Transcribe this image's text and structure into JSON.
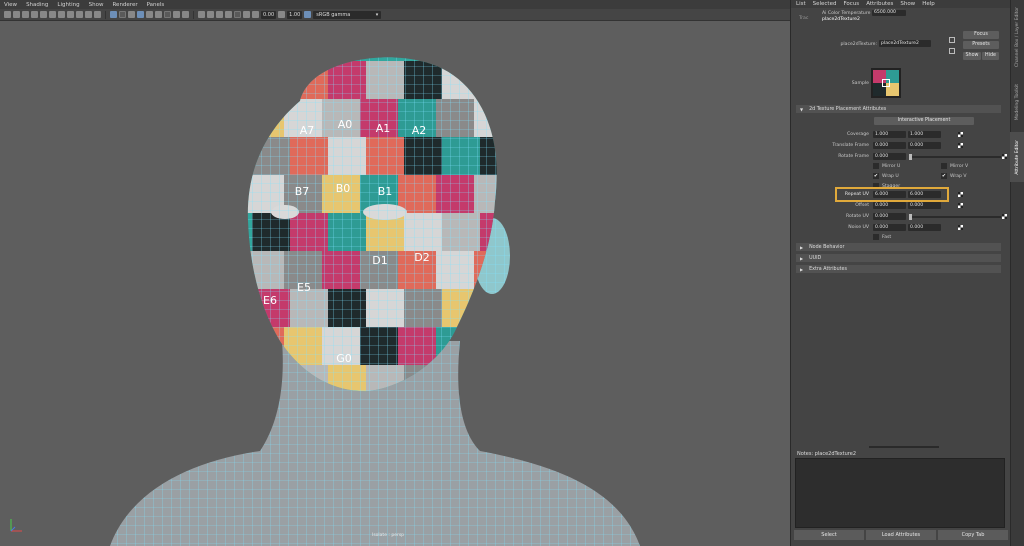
{
  "viewport": {
    "menu": [
      "View",
      "Shading",
      "Lighting",
      "Show",
      "Renderer",
      "Panels"
    ],
    "toolbar": {
      "field1": "0.00",
      "field2": "1.00",
      "colorspace": "sRGB gamma"
    },
    "label": "Isolate : persp",
    "uv_tiles": {
      "row1": [
        "A7",
        "A0",
        "A1",
        "A2"
      ],
      "row2": [
        "B7",
        "B0",
        "B1"
      ],
      "row3": [
        "D1",
        "D2"
      ],
      "row4": [
        "E6",
        "E5"
      ],
      "row5": [
        "G0"
      ]
    },
    "colors": {
      "background": "#5e5e5e",
      "wireframe": "#7fe3ff"
    }
  },
  "panel": {
    "menu": [
      "List",
      "Selected",
      "Focus",
      "Attributes",
      "Show",
      "Help"
    ],
    "top_tab": {
      "prefix": "Trac",
      "name": "place2dTexture2"
    },
    "ai_color_temp": {
      "label": "Ai Color Temperature",
      "value": "6500.000"
    },
    "node": {
      "label": "place2dTexture:",
      "value": "place2dTexture2"
    },
    "buttons": {
      "focus": "Focus",
      "presets": "Presets",
      "show": "Show",
      "hide": "Hide"
    },
    "sample_label": "Sample",
    "section_main": "2d Texture Placement Attributes",
    "interactive_placement": "Interactive Placement",
    "rows": {
      "coverage": {
        "label": "Coverage",
        "v1": "1.000",
        "v2": "1.000"
      },
      "translate_frame": {
        "label": "Translate Frame",
        "v1": "0.000",
        "v2": "0.000"
      },
      "rotate_frame": {
        "label": "Rotate Frame",
        "v1": "0.000"
      },
      "repeat_uv": {
        "label": "Repeat UV",
        "v1": "6.000",
        "v2": "6.000"
      },
      "offset": {
        "label": "Offset",
        "v1": "0.000",
        "v2": "0.000"
      },
      "rotate_uv": {
        "label": "Rotate UV",
        "v1": "0.000"
      },
      "noise_uv": {
        "label": "Noise UV",
        "v1": "0.000",
        "v2": "0.000"
      }
    },
    "checks": {
      "mirror_u": "Mirror U",
      "mirror_v": "Mirror V",
      "wrap_u": "Wrap U",
      "wrap_v": "Wrap V",
      "stagger": "Stagger",
      "fast": "Fast"
    },
    "sections": [
      "Node Behavior",
      "UUID",
      "Extra Attributes"
    ],
    "vtabs": [
      "Channel Box / Layer Editor",
      "Modeling Toolkit",
      "Attribute Editor"
    ],
    "notes_label": "Notes:  place2dTexture2",
    "bottom_buttons": {
      "select": "Select",
      "load": "Load Attributes",
      "copy": "Copy Tab"
    },
    "accent_color": "#e0a93b"
  }
}
